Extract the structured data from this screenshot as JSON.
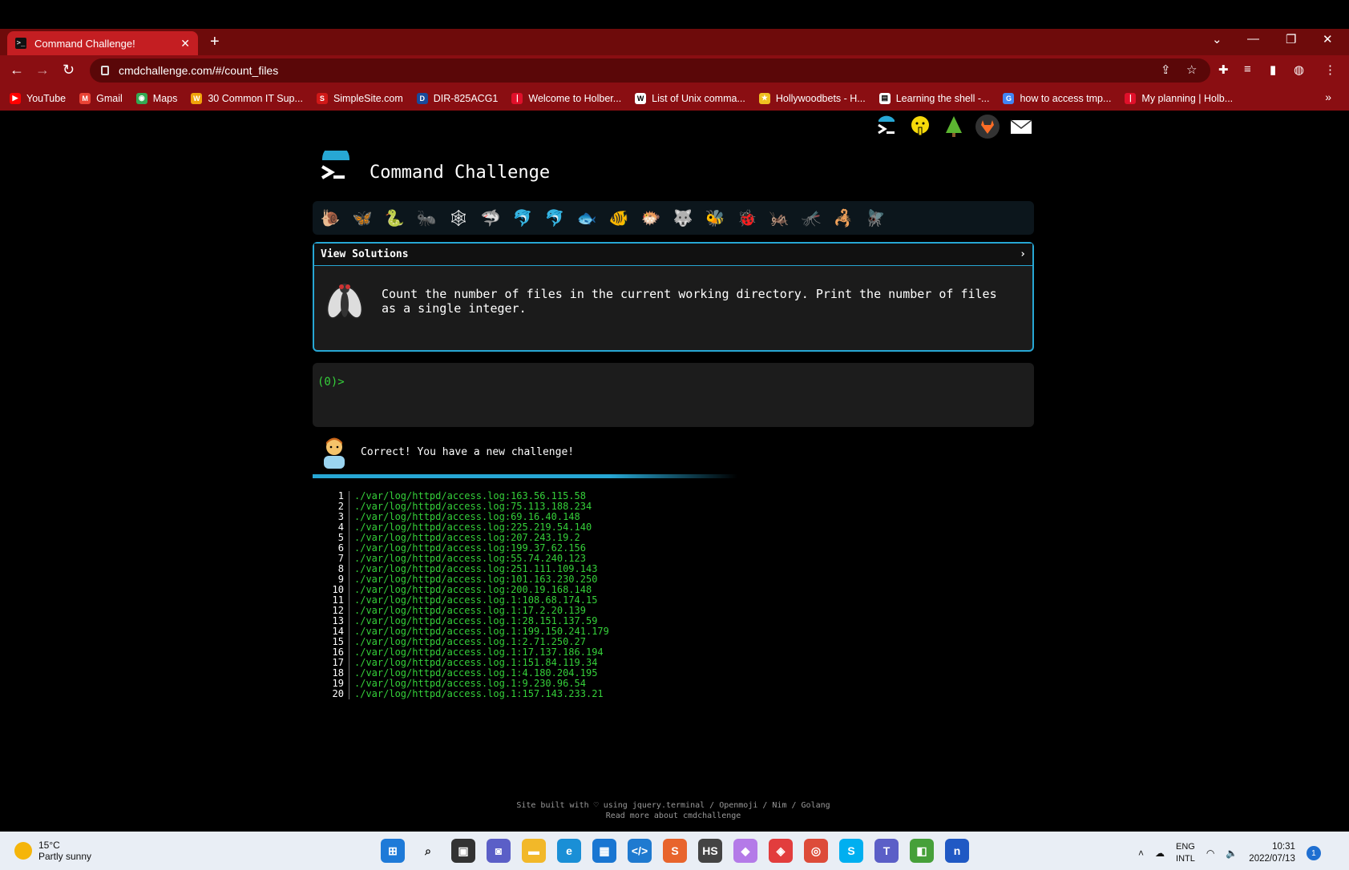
{
  "browser": {
    "tab_title": "Command Challenge!",
    "url": "cmdchallenge.com/#/count_files",
    "bookmarks": [
      {
        "label": "YouTube",
        "color": "#ff0000",
        "glyph": "▶"
      },
      {
        "label": "Gmail",
        "color": "#ea4335",
        "glyph": "M"
      },
      {
        "label": "Maps",
        "color": "#34a853",
        "glyph": "◉"
      },
      {
        "label": "30 Common IT Sup...",
        "color": "#f0a30a",
        "glyph": "W"
      },
      {
        "label": "SimpleSite.com",
        "color": "#d01818",
        "glyph": "S"
      },
      {
        "label": "DIR-825ACG1",
        "color": "#1a4a9a",
        "glyph": "D"
      },
      {
        "label": "Welcome to Holber...",
        "color": "#e0102a",
        "glyph": "❘"
      },
      {
        "label": "List of Unix comma...",
        "color": "#ffffff",
        "glyph": "W"
      },
      {
        "label": "Hollywoodbets - H...",
        "color": "#f0c020",
        "glyph": "★"
      },
      {
        "label": "Learning the shell -...",
        "color": "#ffffff",
        "glyph": "▤"
      },
      {
        "label": "how to access tmp...",
        "color": "#4285f4",
        "glyph": "G"
      },
      {
        "label": "My planning | Holb...",
        "color": "#e0102a",
        "glyph": "❘"
      }
    ]
  },
  "site": {
    "title": "Command Challenge"
  },
  "solutions": {
    "header": "View Solutions",
    "description": "Count the number of files in the current working directory. Print the number of files as a single integer."
  },
  "terminal": {
    "prompt": "(0)>"
  },
  "status": {
    "message": "Correct! You have a new challenge!"
  },
  "output_lines": [
    "./var/log/httpd/access.log:163.56.115.58",
    "./var/log/httpd/access.log:75.113.188.234",
    "./var/log/httpd/access.log:69.16.40.148",
    "./var/log/httpd/access.log:225.219.54.140",
    "./var/log/httpd/access.log:207.243.19.2",
    "./var/log/httpd/access.log:199.37.62.156",
    "./var/log/httpd/access.log:55.74.240.123",
    "./var/log/httpd/access.log:251.111.109.143",
    "./var/log/httpd/access.log:101.163.230.250",
    "./var/log/httpd/access.log:200.19.168.148",
    "./var/log/httpd/access.log.1:108.68.174.15",
    "./var/log/httpd/access.log.1:17.2.20.139",
    "./var/log/httpd/access.log.1:28.151.137.59",
    "./var/log/httpd/access.log.1:199.150.241.179",
    "./var/log/httpd/access.log.1:2.71.250.27",
    "./var/log/httpd/access.log.1:17.137.186.194",
    "./var/log/httpd/access.log.1:151.84.119.34",
    "./var/log/httpd/access.log.1:4.180.204.195",
    "./var/log/httpd/access.log.1:9.230.96.54",
    "./var/log/httpd/access.log.1:157.143.233.21"
  ],
  "footer": {
    "line1": "Site built with ♡ using jquery.terminal / Openmoji / Nim / Golang",
    "line2": "Read more about cmdchallenge"
  },
  "taskbar": {
    "temperature": "15°C",
    "weather": "Partly sunny",
    "lang_1": "ENG",
    "lang_2": "INTL",
    "time": "10:31",
    "date": "2022/07/13",
    "notifications": "1"
  }
}
